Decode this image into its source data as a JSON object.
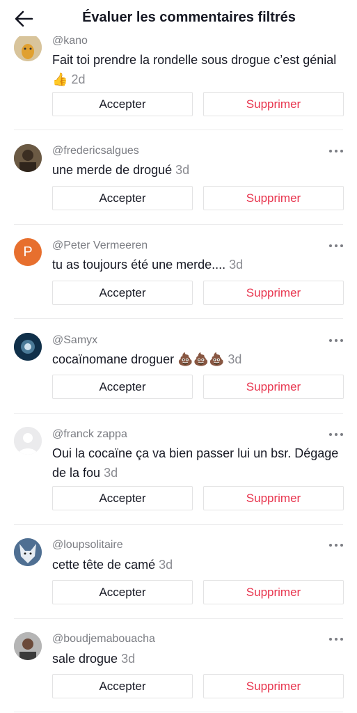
{
  "header": {
    "title": "Évaluer les commentaires filtrés",
    "back_icon": "arrow-left-icon"
  },
  "buttons": {
    "accept": "Accepter",
    "delete": "Supprimer"
  },
  "colors": {
    "delete_text": "#e8364f",
    "secondary_text": "#7b7d83",
    "avatar_p": "#e76f2e"
  },
  "comments": [
    {
      "username": "@kano",
      "text": "Fait toi prendre la rondelle sous drogue c’est génial 👍",
      "time": "2d",
      "avatar": "cartoon-avatar"
    },
    {
      "username": "@fredericsalgues",
      "text": "une merde de drogué",
      "time": "3d",
      "avatar": "photo-avatar"
    },
    {
      "username": "@Peter Vermeeren",
      "text": "tu as toujours été une merde....",
      "time": "3d",
      "avatar": "letter-avatar",
      "avatar_letter": "P"
    },
    {
      "username": "@Samyx",
      "text": "cocaïnomane droguer 💩💩💩",
      "time": "3d",
      "avatar": "photo-avatar"
    },
    {
      "username": "@franck zappa",
      "text": "Oui la cocaïne ça va bien passer lui un bsr. Dégage de la fou",
      "time": "3d",
      "avatar": "default-avatar"
    },
    {
      "username": "@loupsolitaire",
      "text": "cette tête de camé",
      "time": "3d",
      "avatar": "wolf-photo-avatar"
    },
    {
      "username": "@boudjemabouacha",
      "text": "sale drogue",
      "time": "3d",
      "avatar": "photo-avatar"
    }
  ]
}
